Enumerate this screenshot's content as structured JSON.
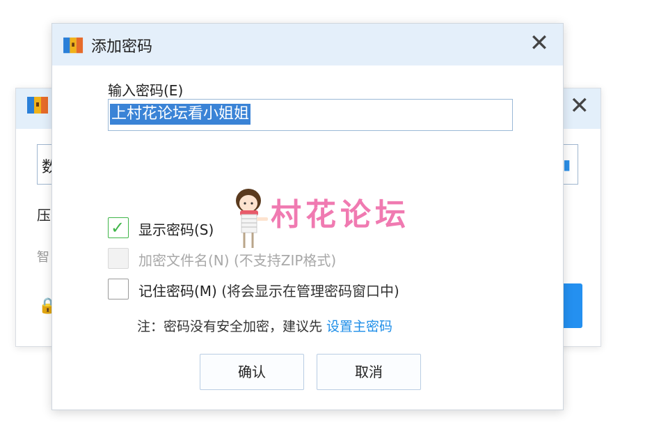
{
  "background_window": {
    "input_text": "数",
    "label1": "压",
    "label2": "智",
    "close_glyph": "✕",
    "lock_icon": "lock-icon"
  },
  "dialog": {
    "title": "添加密码",
    "close_glyph": "✕",
    "password_label": "输入密码(E)",
    "password_value": "上村花论坛看小姐姐",
    "show_password": {
      "label": "显示密码(S)",
      "checked": true
    },
    "encrypt_filenames": {
      "label": "加密文件名(N)",
      "note": "(不支持ZIP格式)",
      "disabled": true
    },
    "remember_password": {
      "label": "记住密码(M)",
      "note": "(将会显示在管理密码窗口中)",
      "checked": false
    },
    "note_text": "注：密码没有安全加密，建议先 ",
    "note_link": "设置主密码",
    "ok_button": "确认",
    "cancel_button": "取消"
  },
  "watermark": {
    "text": "村花论坛"
  },
  "colors": {
    "accent": "#1e8ee8",
    "selection": "#3a83d6",
    "check": "#3fb548",
    "watermark": "#f07ab1",
    "titlebar": "#e4effa"
  }
}
